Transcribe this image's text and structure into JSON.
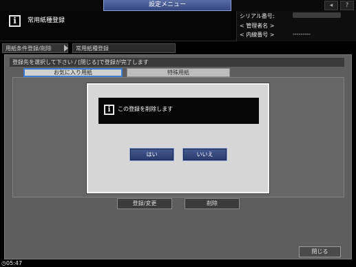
{
  "topbar": {
    "menu_title": "設定メニュー",
    "icons": [
      "speaker-icon",
      "help-icon"
    ],
    "help_label": "?"
  },
  "header": {
    "title": "常用紙種登録",
    "serial_label": "シリアル番号:",
    "admin_label": "< 管理者名 >",
    "internal_label": "< 内線番号 >",
    "internal_value": "---------"
  },
  "breadcrumb": {
    "items": [
      "用紙条件登録/削除",
      "常用紙種登録"
    ]
  },
  "main": {
    "instruction": "登録先を選択して下さい / [閉じる]で登録が完了します",
    "tabs": [
      {
        "label": "お気に入り用紙",
        "selected": true
      },
      {
        "label": "特殊用紙",
        "selected": false
      }
    ],
    "register_label": "登録/変更",
    "delete_label": "削除",
    "close_label": "閉じる"
  },
  "dialog": {
    "message": "この登録を削除します",
    "yes_label": "はい",
    "no_label": "いいえ"
  },
  "footer": {
    "time": "05:47"
  },
  "colors": {
    "accent_blue": "#3d7bd6",
    "dialog_button": "#34467a",
    "panel_gray": "#5e5e5e"
  }
}
